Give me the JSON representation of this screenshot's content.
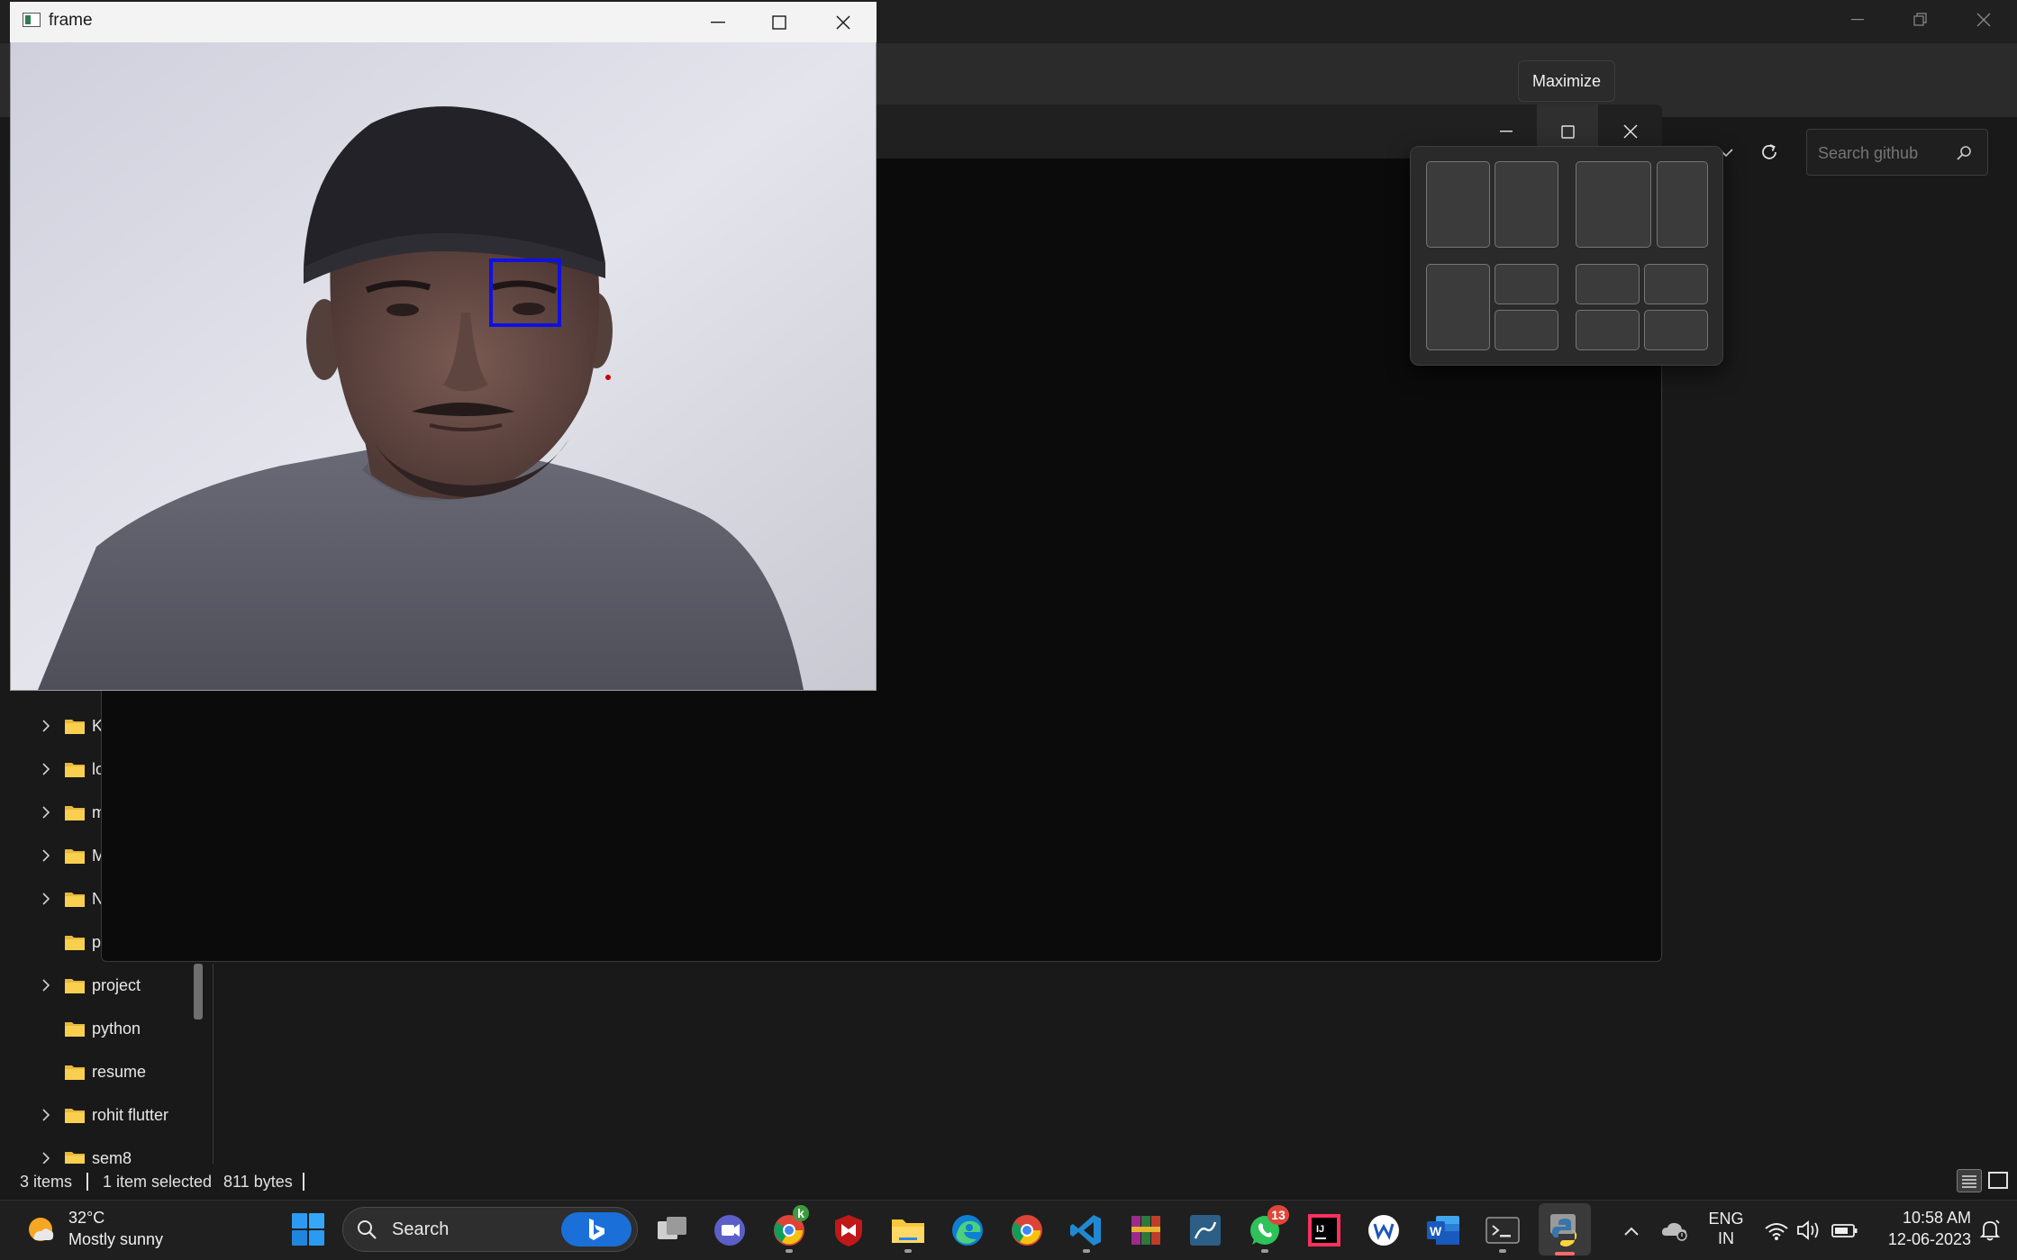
{
  "frame_window": {
    "title": "frame",
    "overlay_box_color": "#1010e0",
    "overlay_dot_color": "#cc0000"
  },
  "dark_window": {
    "tooltip": "Maximize"
  },
  "explorer": {
    "search_placeholder": "Search github",
    "tree": [
      {
        "label": "K",
        "expandable": true
      },
      {
        "label": "lo",
        "expandable": true
      },
      {
        "label": "m",
        "expandable": true
      },
      {
        "label": "M",
        "expandable": true
      },
      {
        "label": "N",
        "expandable": true
      },
      {
        "label": "p",
        "expandable": false
      },
      {
        "label": "project",
        "expandable": true
      },
      {
        "label": "python",
        "expandable": false
      },
      {
        "label": "resume",
        "expandable": false
      },
      {
        "label": "rohit flutter",
        "expandable": true
      },
      {
        "label": "sem8",
        "expandable": true
      }
    ],
    "status": {
      "items": "3 items",
      "selected": "1 item selected",
      "size": "811 bytes"
    }
  },
  "taskbar": {
    "weather_temp": "32°C",
    "weather_cond": "Mostly sunny",
    "search_label": "Search",
    "chrome_profile_badge": "k",
    "whatsapp_badge": "13",
    "lang_line1": "ENG",
    "lang_line2": "IN",
    "time": "10:58 AM",
    "date": "12-06-2023",
    "accent": "#ff6a6a"
  }
}
